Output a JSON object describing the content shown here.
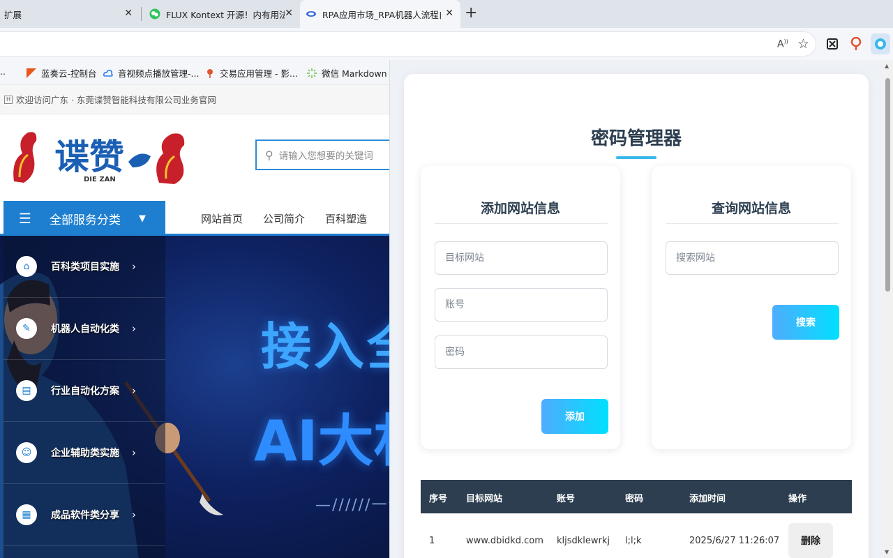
{
  "browser": {
    "tabs": [
      {
        "title": "扩展",
        "active": false
      },
      {
        "title": "FLUX Kontext 开源！内有用法及模型",
        "active": false
      },
      {
        "title": "RPA应用市场_RPA机器人流程自动化",
        "active": true
      }
    ],
    "bookmarks": [
      {
        "label": "...",
        "icon": "page-icon"
      },
      {
        "label": "蓝奏云-控制台",
        "icon": "lanzou-icon"
      },
      {
        "label": "音视频点播放管理-...",
        "icon": "cloud-icon"
      },
      {
        "label": "交易应用管理 - 影...",
        "icon": "pin-icon"
      },
      {
        "label": "微信 Markdown 编...",
        "icon": "spark-icon"
      }
    ],
    "toolbar_icons": [
      "read-aloud-icon",
      "favorite-star-icon",
      "extension-scissors-icon",
      "extension-pin-icon",
      "extension-active-icon"
    ]
  },
  "site": {
    "welcome": "欢迎访问广东 · 东莞谍赞智能科技有限公司业务官网",
    "logo_text": "谍赞",
    "logo_sub": "DIE ZAN",
    "search_placeholder": "请输入您想要的关键词",
    "all_categories": "全部服务分类",
    "nav": [
      "网站首页",
      "公司简介",
      "百科塑造"
    ],
    "categories": [
      {
        "label": "百科类项目实施",
        "icon": "house-gear-icon"
      },
      {
        "label": "机器人自动化类",
        "icon": "pen-icon"
      },
      {
        "label": "行业自动化方案",
        "icon": "document-icon"
      },
      {
        "label": "企业辅助类实施",
        "icon": "user-card-icon"
      },
      {
        "label": "成品软件类分享",
        "icon": "window-icon"
      }
    ],
    "hero_line1": "接入全",
    "hero_line2": "AI大杉",
    "hero_sub": "—//////一谍赞"
  },
  "panel": {
    "title": "密码管理器",
    "add": {
      "title": "添加网站信息",
      "site_placeholder": "目标网站",
      "account_placeholder": "账号",
      "password_placeholder": "密码",
      "button": "添加"
    },
    "query": {
      "title": "查询网站信息",
      "search_placeholder": "搜索网站",
      "button": "搜索"
    },
    "table": {
      "headers": [
        "序号",
        "目标网站",
        "账号",
        "密码",
        "添加时间",
        "操作"
      ],
      "rows": [
        {
          "index": "1",
          "site": "www.dbidkd.com",
          "account": "kljsdklewrkj",
          "password": "l;l;k",
          "time": "2025/6/27 11:26:07",
          "action": "删除"
        }
      ]
    }
  },
  "colors": {
    "accent_blue": "#1e7fd1",
    "gradient_start": "#4facfe",
    "gradient_end": "#00e0fe",
    "table_header": "#2c3e50"
  }
}
